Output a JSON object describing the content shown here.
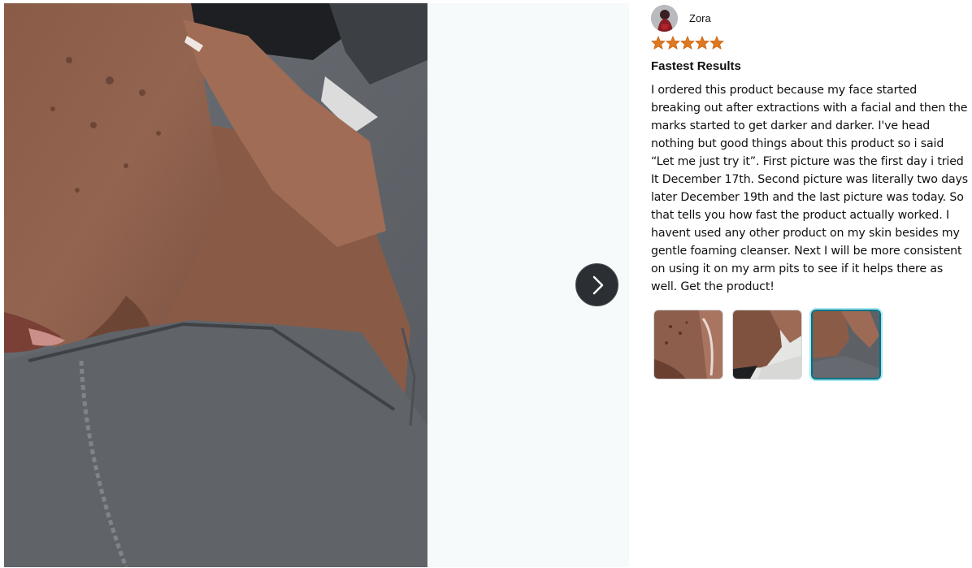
{
  "viewer": {
    "next_button_icon": "chevron-right-icon",
    "background_color": "#f7fafa"
  },
  "review": {
    "reviewer_name": "Zora",
    "rating": 5,
    "rating_max": 5,
    "star_color": "#de7921",
    "title": "Fastest Results",
    "body": "I ordered this product because my face started breaking out after extractions with a facial and then the marks started to get darker and darker. I've head nothing but good things about this product so i said “Let me just try it”. First picture was the first day i tried It December 17th. Second picture was literally two days later December 19th and the last picture was today. So that tells you how fast the product actually worked. I havent used any other product on my skin besides my gentle foaming cleanser. Next I will be more consistent on using it on my arm pits to see if it helps there as well. Get the product!",
    "images": [
      {
        "selected": false
      },
      {
        "selected": false
      },
      {
        "selected": true
      }
    ]
  },
  "colors": {
    "selected_thumb_border": "#007185",
    "text": "#0f1111"
  }
}
